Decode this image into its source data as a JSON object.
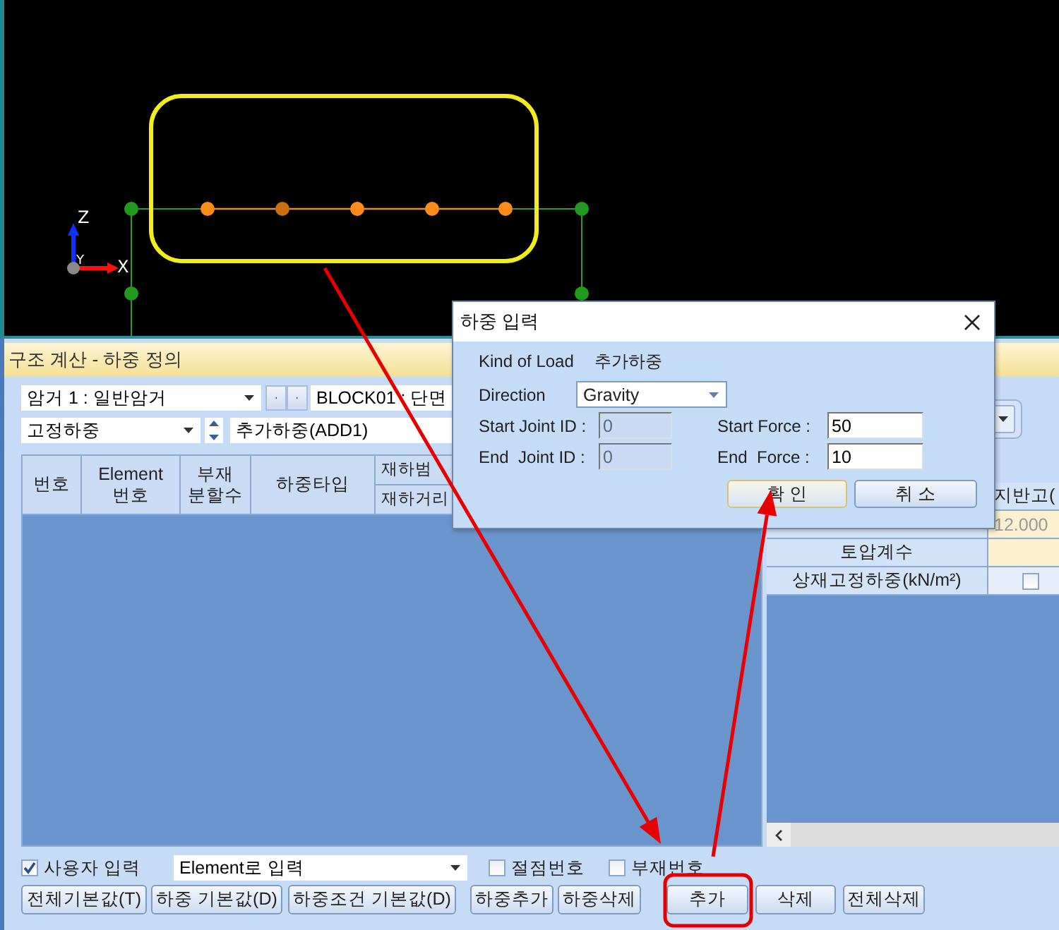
{
  "viewport": {
    "axes": [
      {
        "kind": "z",
        "label": "Z"
      },
      {
        "kind": "y",
        "label": "Y"
      },
      {
        "kind": "x",
        "label": "X"
      }
    ]
  },
  "window": {
    "title": "구조 계산 - 하중 정의"
  },
  "selectors": {
    "culvert": "암거 1 : 일반암거",
    "block": "BLOCK01 : 단면",
    "load_case": "고정하중",
    "load_name": "추가하중(ADD1)"
  },
  "load_table": {
    "columns": [
      {
        "label": "번호"
      },
      {
        "label": "Element 번호"
      },
      {
        "label": "부재 분할수"
      },
      {
        "label": "하중타입"
      },
      {
        "label": "재하범",
        "sub_label": "재하거리"
      }
    ]
  },
  "property_table": {
    "rows": [
      {
        "kind": "header",
        "value": "지반고("
      },
      {
        "kind": "value",
        "value": "12.000",
        "disabled": true
      },
      {
        "kind": "label",
        "label": "토압계수"
      },
      {
        "kind": "check",
        "label": "상재고정하중(kN/m²)",
        "checked": false
      }
    ]
  },
  "options": {
    "user_input": {
      "label": "사용자 입력",
      "checked": true
    },
    "input_mode": "Element로 입력",
    "node_numbers": {
      "label": "절점번호",
      "checked": false
    },
    "member_numbers": {
      "label": "부재번호",
      "checked": false
    }
  },
  "buttons": [
    "전체기본값(T)",
    "하중 기본값(D)",
    "하중조건 기본값(D)",
    "하중추가",
    "하중삭제",
    "추가",
    "삭제",
    "전체삭제"
  ],
  "dialog": {
    "title": "하중 입력",
    "kind_of_load": {
      "label": "Kind of Load",
      "value": "추가하중"
    },
    "direction": {
      "label": "Direction",
      "value": "Gravity"
    },
    "fields": [
      {
        "label": "Start Joint ID :",
        "value": "0",
        "disabled": true
      },
      {
        "label": "Start Force :",
        "value": "50",
        "disabled": false
      },
      {
        "label": "End  Joint ID :",
        "value": "0",
        "disabled": true
      },
      {
        "label": "End  Force :",
        "value": "10",
        "disabled": false
      }
    ],
    "buttons": [
      {
        "label": "확 인",
        "focused": true
      },
      {
        "label": "취 소",
        "focused": false
      }
    ]
  }
}
